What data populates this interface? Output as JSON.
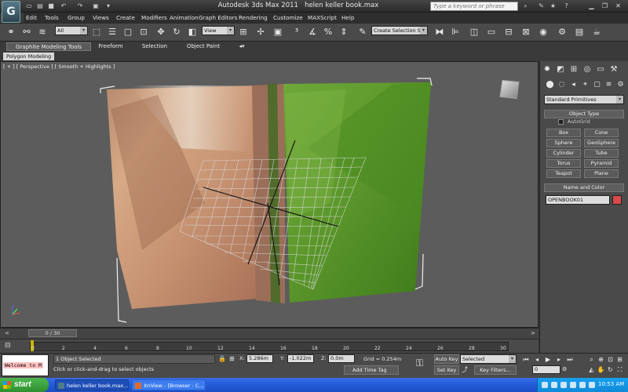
{
  "window": {
    "title": "Autodesk 3ds Max  2011",
    "file": "helen keller book.max",
    "search_placeholder": "Type a keyword or phrase"
  },
  "app_logo": "G",
  "menu": [
    "Edit",
    "Tools",
    "Group",
    "Views",
    "Create",
    "Modifiers",
    "Animation",
    "Graph Editors",
    "Rendering",
    "Customize",
    "MAXScript",
    "Help"
  ],
  "toolbar": {
    "filter": "All",
    "ref_coord": "View",
    "selection_set": "Create Selection Se"
  },
  "ribbon": {
    "tabs": [
      "Graphite Modeling Tools",
      "Freeform",
      "Selection",
      "Object Paint"
    ],
    "subtab": "Polygon Modeling"
  },
  "viewport": {
    "label": "[ + ] [ Perspective ] [ Smooth + Highlights ]"
  },
  "command_panel": {
    "category": "Standard Primitives",
    "object_type_header": "Object Type",
    "autogrid_label": "AutoGrid",
    "buttons": [
      "Box",
      "Cone",
      "Sphere",
      "GeoSphere",
      "Cylinder",
      "Tube",
      "Torus",
      "Pyramid",
      "Teapot",
      "Plane"
    ],
    "name_color_header": "Name and Color",
    "object_name": "OPENBOOK01",
    "object_color": "#d94a4a"
  },
  "timeline": {
    "slider": "0 / 30",
    "ticks": [
      "0",
      "2",
      "4",
      "6",
      "8",
      "10",
      "12",
      "14",
      "16",
      "18",
      "20",
      "22",
      "24",
      "26",
      "28",
      "30"
    ]
  },
  "status": {
    "maxscript": "Welcome to M",
    "selected_count": "1 Object Selected",
    "prompt": "Click or click-and-drag to select objects",
    "x_label": "X:",
    "x_value": "5.286m",
    "y_label": "Y:",
    "y_value": "-1.022m",
    "z_label": "Z:",
    "z_value": "0.0m",
    "grid": "Grid = 0.254m",
    "add_time_tag": "Add Time Tag",
    "auto_key": "Auto Key",
    "set_key": "Set Key",
    "key_mode": "Selected",
    "key_filters": "Key Filters...",
    "frame": "0"
  },
  "taskbar": {
    "start": "start",
    "tasks": [
      "helen keller book.max...",
      "XnView - [Browser - C..."
    ],
    "clock": "10:53 AM"
  }
}
